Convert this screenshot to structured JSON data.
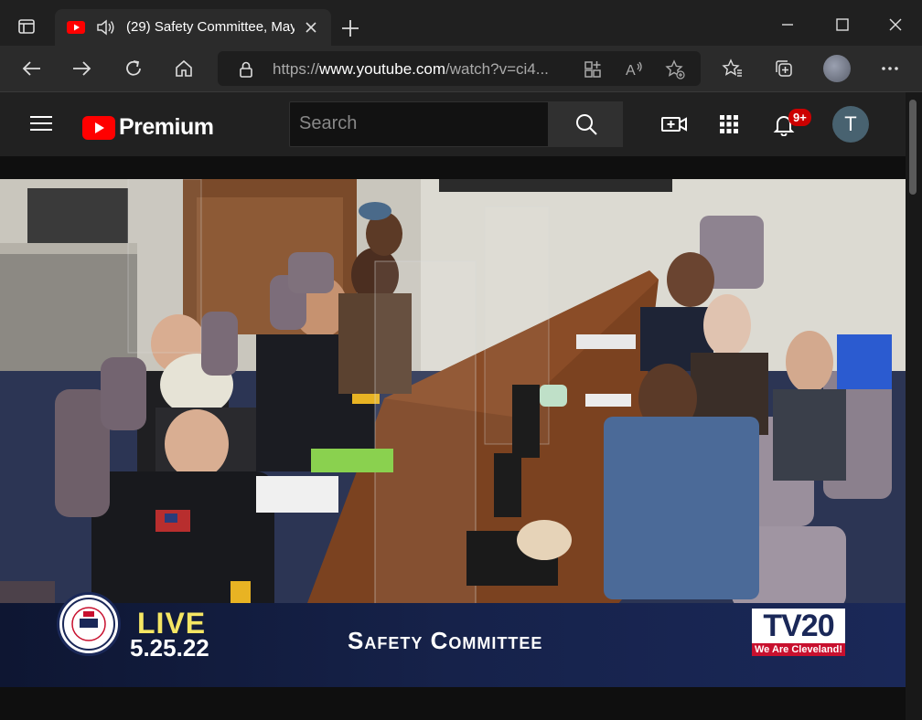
{
  "browser": {
    "tab_title": "(29) Safety Committee, May",
    "url_prefix": "https://",
    "url_host": "www.youtube.com",
    "url_path": "/watch?v=ci4..."
  },
  "youtube": {
    "logo_text": "Premium",
    "search_placeholder": "Search",
    "notification_badge": "9+",
    "user_initial": "T"
  },
  "video": {
    "live_label": "LIVE",
    "date": "5.25.22",
    "committee_title": "Safety Committee",
    "seal_text": "CLEVELAND CITY COUNCIL",
    "seal_year": "1796",
    "station_logo": "TV20",
    "station_tagline": "We Are Cleveland!"
  },
  "colors": {
    "youtube_red": "#ff0000",
    "live_yellow": "#f5e663",
    "badge_red": "#cc0000"
  }
}
